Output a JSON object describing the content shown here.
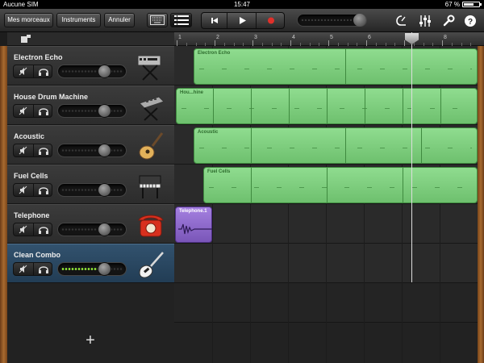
{
  "status_bar": {
    "carrier": "Aucune SIM",
    "time": "15:47",
    "battery": "67 %",
    "battery_level": 0.67
  },
  "toolbar": {
    "my_songs_label": "Mes morceaux",
    "instruments_label": "Instruments",
    "undo_label": "Annuler",
    "icons": [
      "keyboard-icon",
      "tracks-view-icon",
      "rewind-icon",
      "play-icon",
      "record-icon",
      "metronome-icon",
      "mixer-icon",
      "wrench-icon",
      "help-icon"
    ],
    "record_color": "#e0302a"
  },
  "ruler": {
    "bars": [
      "1",
      "2",
      "3",
      "4",
      "5",
      "6",
      "7",
      "8"
    ]
  },
  "tracks": [
    {
      "name": "Electron Echo",
      "instrument_icon": "synth-keyboard-icon",
      "volume": 0.72
    },
    {
      "name": "House Drum Machine",
      "instrument_icon": "drum-machine-icon",
      "volume": 0.72
    },
    {
      "name": "Acoustic",
      "instrument_icon": "acoustic-guitar-icon",
      "volume": 0.72
    },
    {
      "name": "Fuel Cells",
      "instrument_icon": "keyboard-icon",
      "volume": 0.72
    },
    {
      "name": "Telephone",
      "instrument_icon": "telephone-icon",
      "volume": 0.72
    },
    {
      "name": "Clean Combo",
      "instrument_icon": "electric-guitar-icon",
      "volume": 0.72,
      "selected": true
    }
  ],
  "regions": [
    {
      "label": "Electron Echo"
    },
    {
      "label": "Hou...hine"
    },
    {
      "label": "Acoustic"
    },
    {
      "label": "Fuel Cells"
    },
    {
      "label": "Telephone.1"
    }
  ],
  "add_track_label": "+",
  "colors": {
    "region_green": "#7fcf7f",
    "region_purple": "#8a66c8",
    "selected_track": "#2b4a66",
    "level_meter": "#9cff3a"
  }
}
